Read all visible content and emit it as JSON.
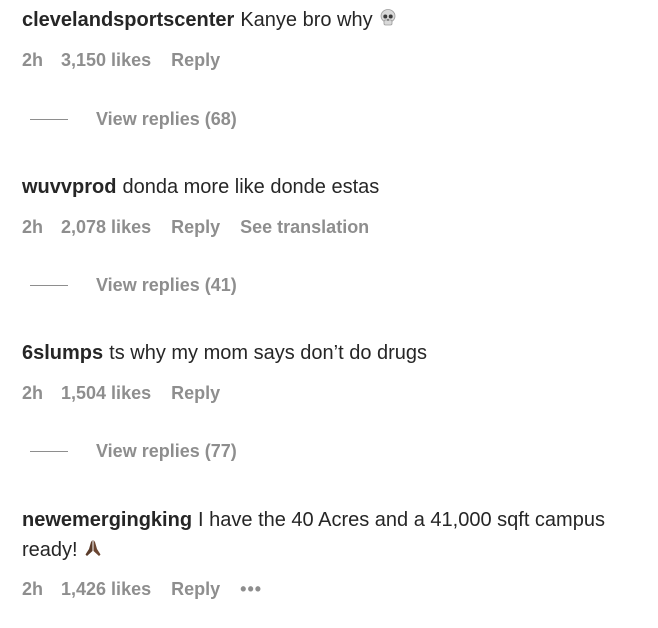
{
  "comments": [
    {
      "username": "clevelandsportscenter",
      "text": "Kanye bro why",
      "emoji": "skull-emoji",
      "time": "2h",
      "likes": "3,150 likes",
      "reply": "Reply",
      "view_replies": "View replies (68)"
    },
    {
      "username": "wuvvprod",
      "text": "donda more like donde estas",
      "time": "2h",
      "likes": "2,078 likes",
      "reply": "Reply",
      "translation": "See translation",
      "view_replies": "View replies (41)"
    },
    {
      "username": "6slumps",
      "text": "ts why my mom says don’t do drugs",
      "time": "2h",
      "likes": "1,504 likes",
      "reply": "Reply",
      "view_replies": "View replies (77)"
    },
    {
      "username": "newemergingking",
      "text": "I have the 40 Acres and a 41,000 sqft campus ready!",
      "emoji": "praying-hands-emoji",
      "time": "2h",
      "likes": "1,426 likes",
      "reply": "Reply",
      "more": "•••"
    }
  ]
}
